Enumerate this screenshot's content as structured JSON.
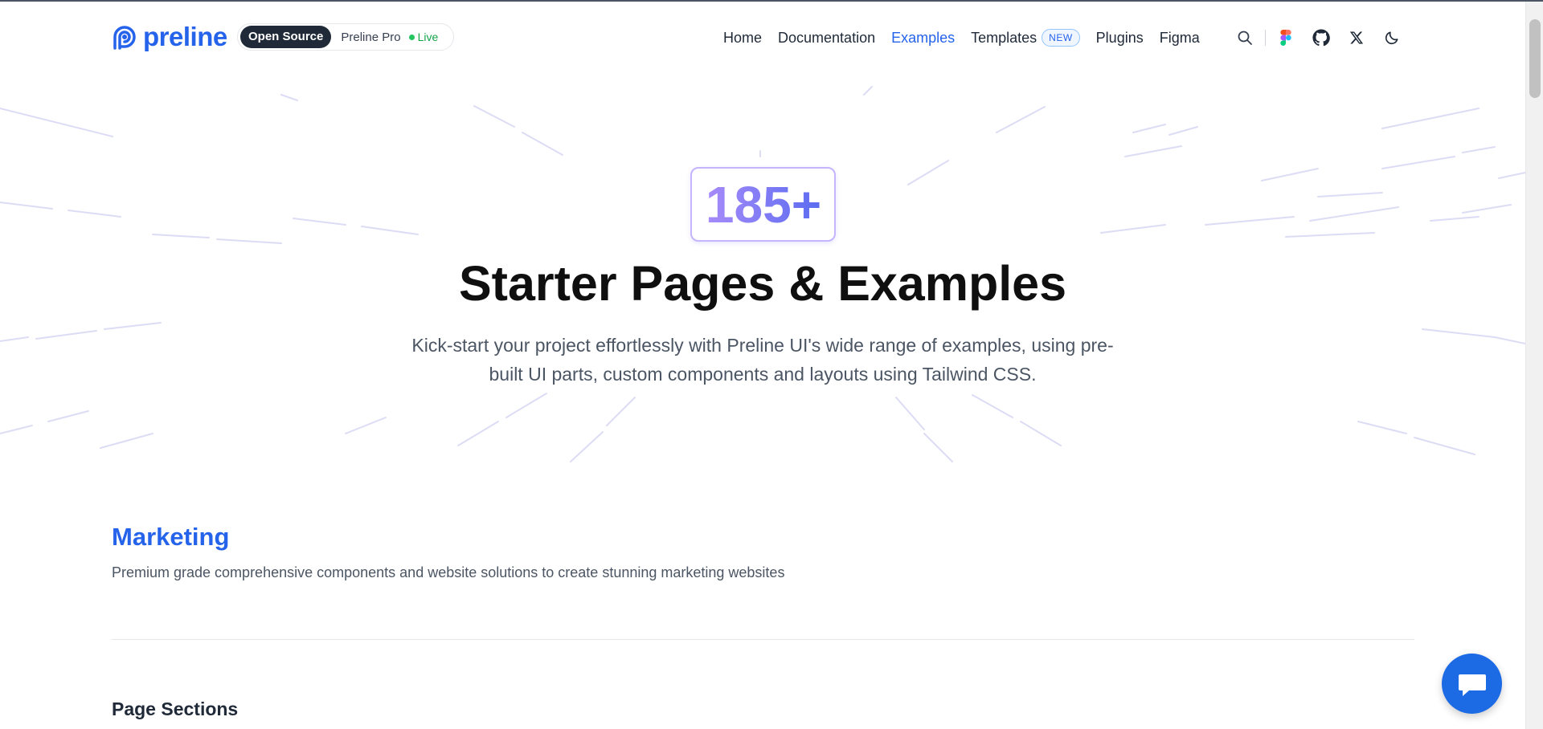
{
  "header": {
    "logo_text": "preline",
    "version_pill": {
      "open_source": "Open Source",
      "pro": "Preline Pro",
      "live": "Live"
    },
    "nav": {
      "home": "Home",
      "documentation": "Documentation",
      "examples": "Examples",
      "templates": "Templates",
      "templates_badge": "NEW",
      "plugins": "Plugins",
      "figma": "Figma"
    },
    "icons": [
      "search-icon",
      "figma-icon",
      "github-icon",
      "x-twitter-icon",
      "moon-icon"
    ]
  },
  "hero": {
    "counter": "185+",
    "title": "Starter Pages & Examples",
    "subtitle": "Kick-start your project effortlessly with Preline UI's wide range of examples, using pre-built UI parts, custom components and layouts using Tailwind CSS."
  },
  "marketing": {
    "title": "Marketing",
    "description": "Premium grade comprehensive components and website solutions to create stunning marketing websites",
    "subsection_title": "Page Sections"
  },
  "colors": {
    "accent": "#2563eb",
    "live": "#16a34a",
    "counter_gradient_start": "#9b7df0",
    "counter_gradient_end": "#5b6cf0"
  }
}
